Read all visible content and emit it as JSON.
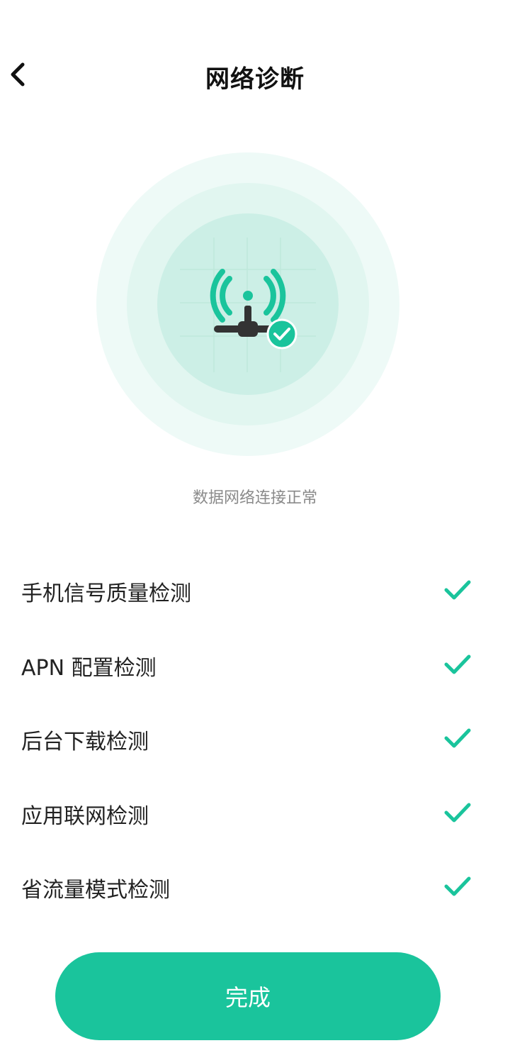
{
  "header": {
    "title": "网络诊断",
    "back_icon": "chevron-left-icon"
  },
  "illustration": {
    "icon": "signal-tower-icon",
    "badge_icon": "check-circle-icon",
    "accent_color": "#1ac49c"
  },
  "status": {
    "message": "数据网络连接正常"
  },
  "checks": [
    {
      "label": "手机信号质量检测",
      "passed": true
    },
    {
      "label": "APN 配置检测",
      "passed": true
    },
    {
      "label": "后台下载检测",
      "passed": true
    },
    {
      "label": "应用联网检测",
      "passed": true
    },
    {
      "label": "省流量模式检测",
      "passed": true
    }
  ],
  "footer": {
    "done_label": "完成"
  },
  "colors": {
    "accent": "#1ac49c",
    "text_primary": "#222222",
    "text_secondary": "#8a8a8a"
  }
}
